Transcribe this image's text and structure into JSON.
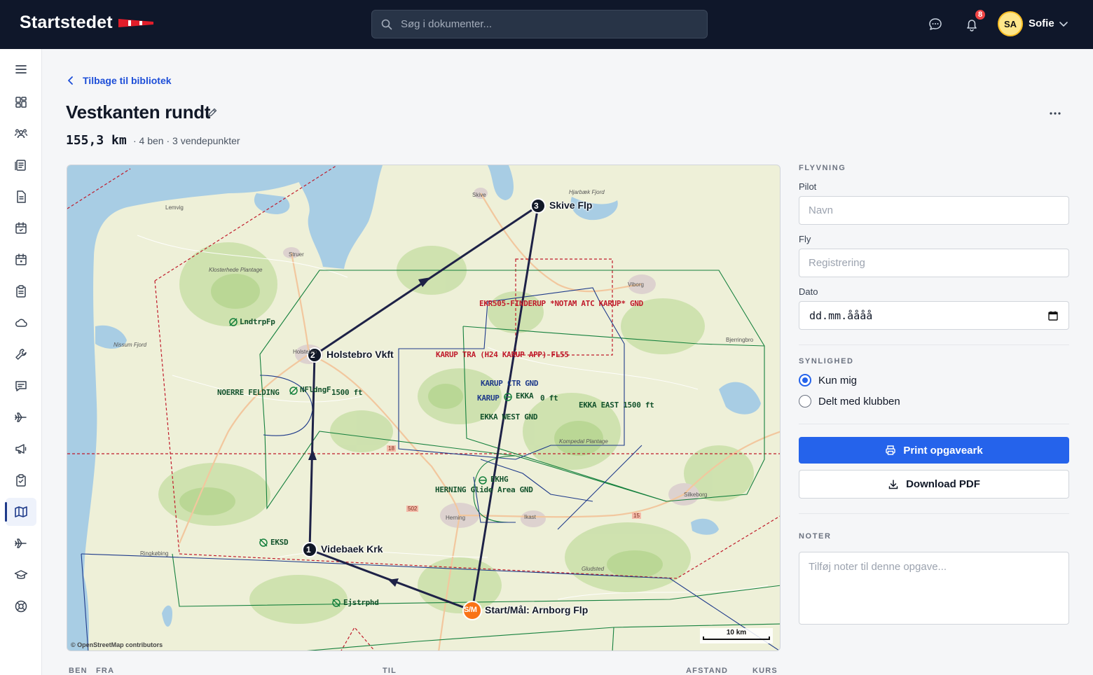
{
  "header": {
    "brand": "Startstedet",
    "search_placeholder": "Søg i dokumenter...",
    "notification_count": "8",
    "user_initials": "SA",
    "user_name": "Sofie"
  },
  "sidebar": {
    "items": [
      {
        "icon": "menu-icon"
      },
      {
        "icon": "dashboard-icon"
      },
      {
        "icon": "members-icon"
      },
      {
        "icon": "library-icon"
      },
      {
        "icon": "document-icon"
      },
      {
        "icon": "calendar-icon"
      },
      {
        "icon": "schedule-icon"
      },
      {
        "icon": "clipboard-icon"
      },
      {
        "icon": "weather-icon"
      },
      {
        "icon": "tools-icon"
      },
      {
        "icon": "messages-icon"
      },
      {
        "icon": "aircraft-icon"
      },
      {
        "icon": "announcement-icon"
      },
      {
        "icon": "checklist-icon"
      },
      {
        "icon": "map-icon",
        "active": true
      },
      {
        "icon": "flights-icon"
      },
      {
        "icon": "training-icon"
      },
      {
        "icon": "help-icon"
      }
    ]
  },
  "page": {
    "back_label": "Tilbage til bibliotek",
    "title": "Vestkanten rundt",
    "distance": "155,3 km",
    "meta": "· 4 ben · 3 vendepunkter"
  },
  "map": {
    "waypoints": [
      {
        "marker": "3",
        "name": "Skive Flp"
      },
      {
        "marker": "2",
        "name": "Holstebro Vkft"
      },
      {
        "marker": "1",
        "name": "Videbaek Krk"
      },
      {
        "marker": "S/M",
        "name": "Start/Mål: Arnborg Flp"
      }
    ],
    "airspace_labels": [
      "EKR505-FINDERUP *NOTAM ATC KARUP* GND",
      "KARUP TRA (H24 KARUP APP) FL55",
      "KARUP CTR GND",
      "KARUP",
      "EKKA",
      "0 ft",
      "EKKA WEST GND",
      "EKKA EAST 1500 ft",
      "NOERRE FELDING",
      "NFldngF",
      "1500 ft",
      "HERNING Glide",
      "Area GND",
      "EKHG"
    ],
    "airfields": [
      "LndtrpFp",
      "EKSD",
      "Ejstrphd"
    ],
    "towns": [
      "Lemvig",
      "Skive",
      "Struer",
      "Viborg",
      "Holstebro",
      "Herning",
      "Ikast",
      "Silkeborg",
      "Bjerringbro",
      "Ringkøbing",
      "Klosterhede Plantage",
      "Nissum Fjord",
      "Hjarbæk Fjord",
      "Kompedal Plantage",
      "Gludsted"
    ],
    "road_numbers": [
      "18",
      "502",
      "15"
    ],
    "attribution": "© OpenStreetMap contributors",
    "scale_label": "10 km"
  },
  "table": {
    "headers": [
      "BEN",
      "FRA",
      "TIL",
      "AFSTAND",
      "KURS"
    ]
  },
  "panel": {
    "flight_section": "FLYVNING",
    "pilot_label": "Pilot",
    "pilot_placeholder": "Navn",
    "aircraft_label": "Fly",
    "aircraft_placeholder": "Registrering",
    "date_label": "Dato",
    "date_placeholder": "dd.mm.åååå",
    "visibility_section": "SYNLIGHED",
    "visibility_options": [
      {
        "label": "Kun mig",
        "checked": true
      },
      {
        "label": "Delt med klubben",
        "checked": false
      }
    ],
    "print_button": "Print opgaveark",
    "pdf_button": "Download PDF",
    "notes_section": "NOTER",
    "notes_placeholder": "Tilføj noter til denne opgave..."
  },
  "colors": {
    "topbar": "#0f172a",
    "primary": "#2563eb",
    "route": "#1e2247",
    "start_marker": "#f97316",
    "airspace_red": "#c01a2a",
    "airspace_green": "#15803d",
    "airspace_navy": "#1e3a8a"
  }
}
